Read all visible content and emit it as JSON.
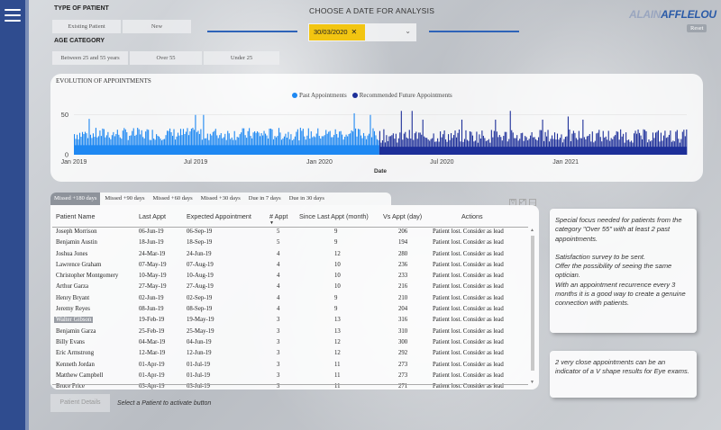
{
  "filters": {
    "patient_type_label": "TYPE OF PATIENT",
    "patient_types": [
      "Existing Patient",
      "New"
    ],
    "age_label": "AGE CATEGORY",
    "age_categories": [
      "Between 25 and 55 years",
      "Over 55",
      "Under 25"
    ]
  },
  "date_selector": {
    "title": "CHOOSE A DATE FOR ANALYSIS",
    "value": "30/03/2020",
    "clear_glyph": "✕",
    "chevron_glyph": "⌄"
  },
  "brand": {
    "part1": "ALAIN",
    "part2": "AFFLELOU",
    "reset_label": "Reset"
  },
  "colors": {
    "past": "#1e88f2",
    "future": "#1d2f99",
    "accent": "#2e63b8",
    "highlight": "#f2c511"
  },
  "chart_data": {
    "type": "bar",
    "title": "EVOLUTION OF APPOINTMENTS",
    "xlabel": "Date",
    "ylabel": "",
    "ylim": [
      0,
      70
    ],
    "yticks": [
      0,
      50
    ],
    "xticks": [
      "Jan 2019",
      "Jul 2019",
      "Jan 2020",
      "Jul 2020",
      "Jan 2021"
    ],
    "x_range": [
      "2019-01-01",
      "2021-06-30"
    ],
    "split_date": "2020-03-30",
    "series": [
      {
        "name": "Past Appointments",
        "typical_range": [
          18,
          34
        ],
        "peaks": [
          45,
          50,
          52
        ]
      },
      {
        "name": "Recommended Future Appointments",
        "typical_range": [
          15,
          32
        ],
        "peaks": [
          44,
          48,
          55
        ]
      }
    ]
  },
  "tabs": [
    "Missed +180 days",
    "Missed +90 days",
    "Missed +60 days",
    "Missed +30 days",
    "Due in 7 days",
    "Due in 30 days"
  ],
  "table": {
    "columns": [
      "Patient Name",
      "Last Appt",
      "Expected Appointment",
      "# Appt",
      "Since Last Appt (month)",
      "Vs Appt (day)",
      "Actions"
    ],
    "rows": [
      [
        "Joseph Morrison",
        "06-Jun-19",
        "06-Sep-19",
        "5",
        "9",
        "206",
        "Patient lost. Consider as lead"
      ],
      [
        "Benjamin Austin",
        "18-Jun-19",
        "18-Sep-19",
        "5",
        "9",
        "194",
        "Patient lost. Consider as lead"
      ],
      [
        "Joshua Jones",
        "24-Mar-19",
        "24-Jun-19",
        "4",
        "12",
        "280",
        "Patient lost. Consider as lead"
      ],
      [
        "Lawrence Graham",
        "07-May-19",
        "07-Aug-19",
        "4",
        "10",
        "236",
        "Patient lost. Consider as lead"
      ],
      [
        "Christopher Montgomery",
        "10-May-19",
        "10-Aug-19",
        "4",
        "10",
        "233",
        "Patient lost. Consider as lead"
      ],
      [
        "Arthur Garza",
        "27-May-19",
        "27-Aug-19",
        "4",
        "10",
        "216",
        "Patient lost. Consider as lead"
      ],
      [
        "Henry Bryant",
        "02-Jun-19",
        "02-Sep-19",
        "4",
        "9",
        "210",
        "Patient lost. Consider as lead"
      ],
      [
        "Jeremy Reyes",
        "08-Jun-19",
        "08-Sep-19",
        "4",
        "9",
        "204",
        "Patient lost. Consider as lead"
      ],
      [
        "Walter Gibson",
        "19-Feb-19",
        "19-May-19",
        "3",
        "13",
        "316",
        "Patient lost. Consider as lead"
      ],
      [
        "Benjamin Garza",
        "25-Feb-19",
        "25-May-19",
        "3",
        "13",
        "310",
        "Patient lost. Consider as lead"
      ],
      [
        "Billy Evans",
        "04-Mar-19",
        "04-Jun-19",
        "3",
        "12",
        "300",
        "Patient lost. Consider as lead"
      ],
      [
        "Eric Armstrong",
        "12-Mar-19",
        "12-Jun-19",
        "3",
        "12",
        "292",
        "Patient lost. Consider as lead"
      ],
      [
        "Kenneth Jordan",
        "01-Apr-19",
        "01-Jul-19",
        "3",
        "11",
        "273",
        "Patient lost. Consider as lead"
      ],
      [
        "Matthew Campbell",
        "01-Apr-19",
        "01-Jul-19",
        "3",
        "11",
        "273",
        "Patient lost. Consider as lead"
      ],
      [
        "Bruce Price",
        "03-Apr-19",
        "03-Jul-19",
        "3",
        "11",
        "271",
        "Patient lost. Consider as lead"
      ]
    ],
    "selected_row": 8
  },
  "footer": {
    "details_button": "Patient Details",
    "hint": "Select a Patient to activate button"
  },
  "notes": {
    "note1_a": "Special focus needed for patients from the category \"Over 55\" with at least 2 past appointments.",
    "note1_b": "Satisfaction survey to be sent.",
    "note1_c": "Offer the possibility of seeing the same optician.",
    "note1_d": "With an appointment recurrence every 3 months it is a good way to create a genuine connection with patients.",
    "note2": "2 very close appointments can be an indicator of a V shape results for Eye exams."
  }
}
